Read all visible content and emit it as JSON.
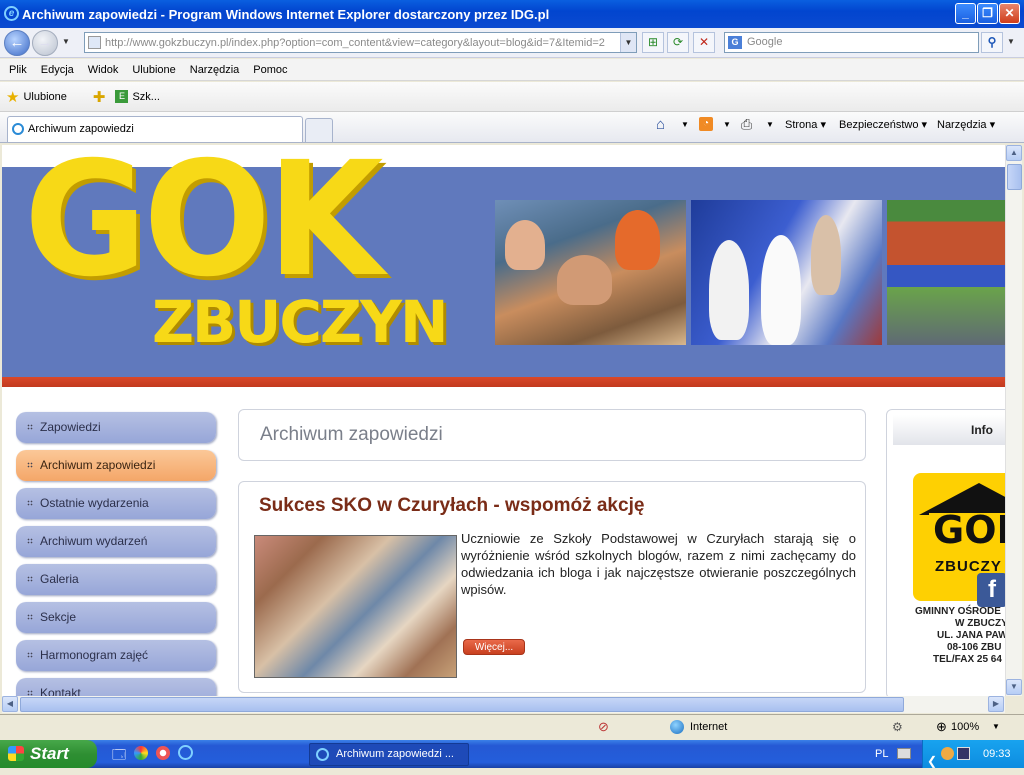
{
  "window": {
    "title": "Archiwum zapowiedzi - Program Windows Internet Explorer dostarczony przez IDG.pl"
  },
  "address": {
    "url": "http://www.gokzbuczyn.pl/index.php?option=com_content&view=category&layout=blog&id=7&Itemid=2"
  },
  "search": {
    "placeholder": "Google"
  },
  "menubar": [
    "Plik",
    "Edycja",
    "Widok",
    "Ulubione",
    "Narzędzia",
    "Pomoc"
  ],
  "favorites": {
    "label": "Ulubione",
    "item": "Szk..."
  },
  "tab": {
    "label": "Archiwum zapowiedzi"
  },
  "commandbar": {
    "strona": "Strona",
    "bezpieczenstwo": "Bezpieczeństwo",
    "narzedzia": "Narzędzia"
  },
  "site": {
    "logo_main": "GOK",
    "logo_sub": "ZBUCZYN",
    "menu": [
      {
        "label": "Zapowiedzi",
        "active": false
      },
      {
        "label": "Archiwum zapowiedzi",
        "active": true
      },
      {
        "label": "Ostatnie wydarzenia",
        "active": false
      },
      {
        "label": "Archiwum wydarzeń",
        "active": false
      },
      {
        "label": "Galeria",
        "active": false
      },
      {
        "label": "Sekcje",
        "active": false
      },
      {
        "label": "Harmonogram zajęć",
        "active": false
      },
      {
        "label": "Kontakt",
        "active": false
      }
    ],
    "page_title": "Archiwum zapowiedzi",
    "article": {
      "title": "Sukces SKO w Czuryłach - wspomóż akcję",
      "text": "Uczniowie ze Szkoły Podstawowej w Czuryłach starają się o wyróżnienie wśród szkolnych blogów, razem z nimi zachęcamy do odwiedzania ich bloga i jak najczęstsze otwieranie poszczególnych wpisów.",
      "more": "Więcej..."
    },
    "info": {
      "title": "Info",
      "logo_text": "GOK",
      "logo_sub": "ZBUCZY",
      "lines": [
        "GMINNY OŚRODE",
        "W ZBUCZY",
        "UL. JANA PAW",
        "08-106 ZBU",
        "TEL/FAX 25 64"
      ]
    }
  },
  "status": {
    "zone": "Internet",
    "zoom": "100%"
  },
  "taskbar": {
    "start": "Start",
    "task": "Archiwum zapowiedzi ...",
    "lang": "PL",
    "clock": "09:33"
  }
}
